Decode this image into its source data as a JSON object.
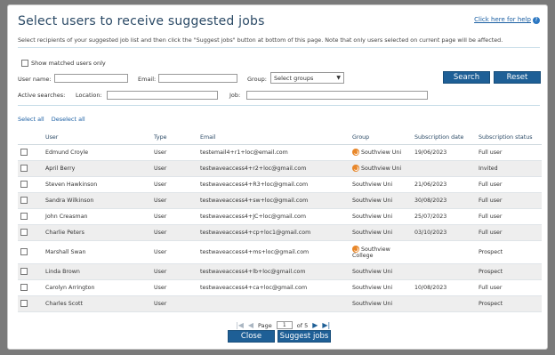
{
  "title": "Select users to receive suggested jobs",
  "help_link": "Click here for help",
  "instructions": "Select recipients of your suggested job list and then click the \"Suggest jobs\" button at bottom of this page. Note that only users selected on current page will be affected.",
  "show_matched_label": "Show matched users only",
  "filters": {
    "username_label": "User name:",
    "email_label": "Email:",
    "group_label": "Group:",
    "group_value": "Select groups",
    "active_searches_label": "Active searches:",
    "location_label": "Location:",
    "job_label": "Job:"
  },
  "buttons": {
    "search": "Search",
    "reset": "Reset",
    "close": "Close",
    "suggest": "Suggest jobs"
  },
  "links": {
    "select_all": "Select all",
    "deselect_all": "Deselect all"
  },
  "columns": [
    "User",
    "Type",
    "Email",
    "Group",
    "Subscription date",
    "Subscription status"
  ],
  "rows": [
    {
      "user": "Edmund Croyle",
      "type": "User",
      "email": "testemail4+r1+loc@email.com",
      "group": "Southview Uni",
      "group_line2": "",
      "icon": true,
      "date": "19/06/2023",
      "status": "Full user"
    },
    {
      "user": "April Berry",
      "type": "User",
      "email": "testwaveaccess4+r2+loc@gmail.com",
      "group": "Southview Uni",
      "group_line2": "",
      "icon": true,
      "date": "",
      "status": "Invited"
    },
    {
      "user": "Steven Hawkinson",
      "type": "User",
      "email": "testwaveaccess4+R3+loc@gmail.com",
      "group": "Southview Uni",
      "group_line2": "",
      "icon": false,
      "date": "21/06/2023",
      "status": "Full user"
    },
    {
      "user": "Sandra Wilkinson",
      "type": "User",
      "email": "testwaveaccess4+sw+loc@gmail.com",
      "group": "Southview Uni",
      "group_line2": "",
      "icon": false,
      "date": "30/08/2023",
      "status": "Full user"
    },
    {
      "user": "John Creasman",
      "type": "User",
      "email": "testwaveaccess4+JC+loc@gmail.com",
      "group": "Southview Uni",
      "group_line2": "",
      "icon": false,
      "date": "25/07/2023",
      "status": "Full user"
    },
    {
      "user": "Charlie Peters",
      "type": "User",
      "email": "testwaveaccess4+cp+loc1@gmail.com",
      "group": "Southview Uni",
      "group_line2": "",
      "icon": false,
      "date": "03/10/2023",
      "status": "Full user"
    },
    {
      "user": "Marshall Swan",
      "type": "User",
      "email": "testwaveaccess4+ms+loc@gmail.com",
      "group": "Southview",
      "group_line2": "College",
      "icon": true,
      "date": "",
      "status": "Prospect"
    },
    {
      "user": "Linda Brown",
      "type": "User",
      "email": "testwaveaccess4+lb+loc@gmail.com",
      "group": "Southview Uni",
      "group_line2": "",
      "icon": false,
      "date": "",
      "status": "Prospect"
    },
    {
      "user": "Carolyn Arrington",
      "type": "User",
      "email": "testwaveaccess4+ca+loc@gmail.com",
      "group": "Southview Uni",
      "group_line2": "",
      "icon": false,
      "date": "10/08/2023",
      "status": "Full user"
    },
    {
      "user": "Charles Scott",
      "type": "User",
      "email": "",
      "group": "Southview Uni",
      "group_line2": "",
      "icon": false,
      "date": "",
      "status": "Prospect"
    }
  ],
  "pager": {
    "page_label": "Page",
    "current": "1",
    "of_label": "of 5"
  }
}
